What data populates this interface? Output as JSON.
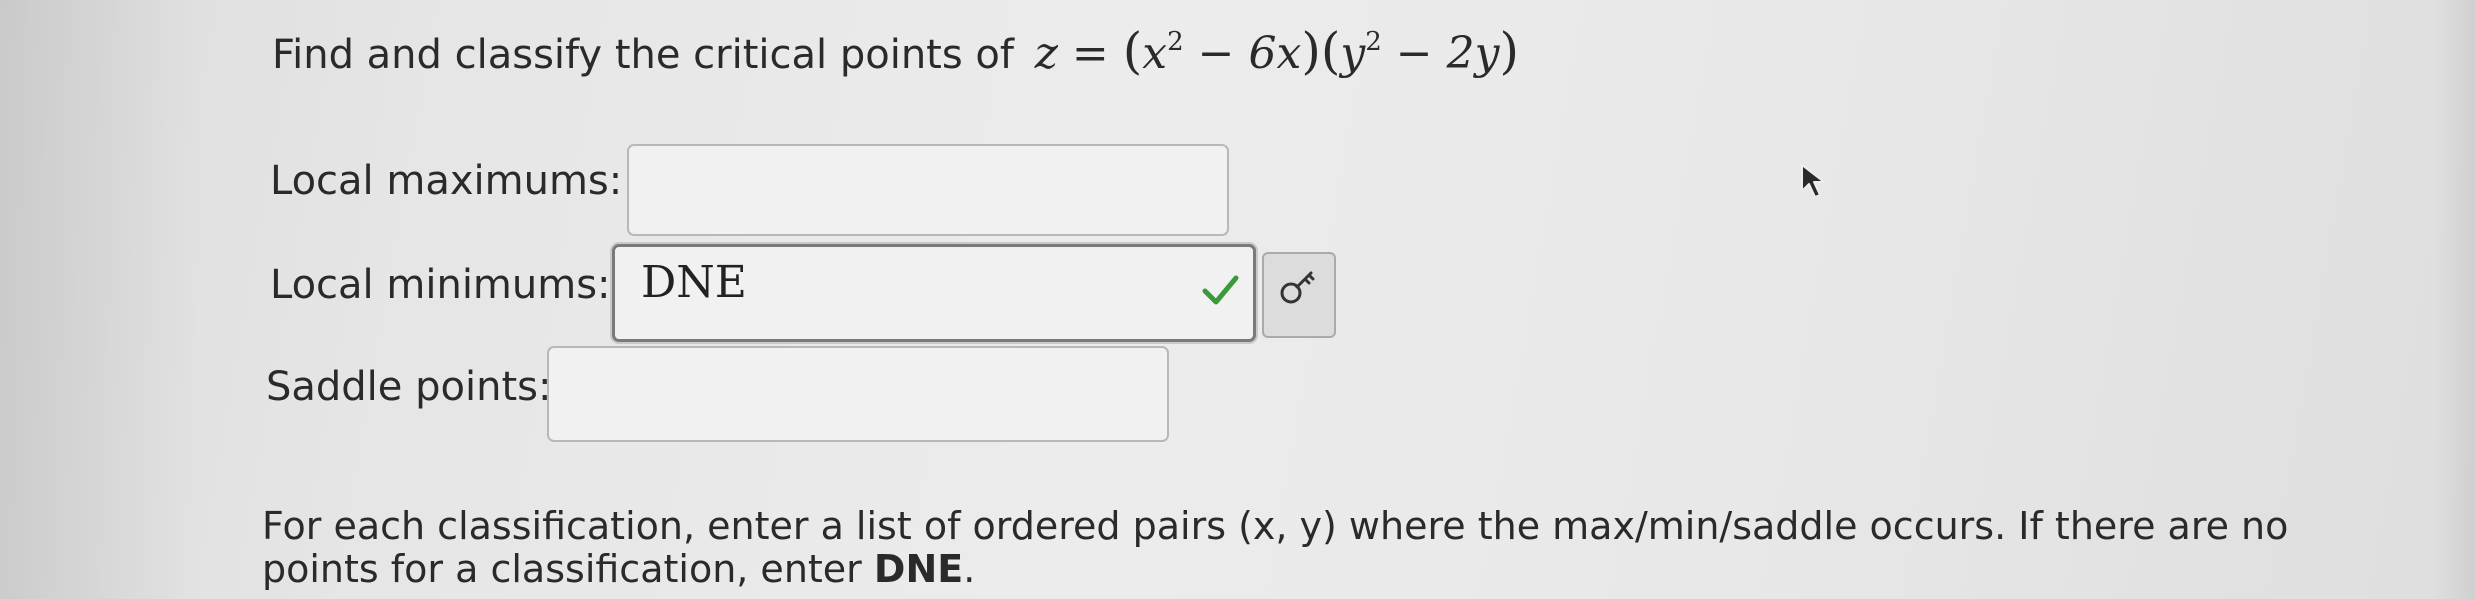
{
  "question": {
    "prompt": "Find and classify the critical points of",
    "equation": {
      "lhs": "z",
      "eq": "=",
      "f1_base": "x",
      "f1_exp": "2",
      "f1_rest": "− 6x",
      "f2_base": "y",
      "f2_exp": "2",
      "f2_rest": "− 2y"
    }
  },
  "fields": {
    "local_max": {
      "label": "Local maximums:",
      "value": ""
    },
    "local_min": {
      "label": "Local minimums:",
      "value": "DNE",
      "status": "correct"
    },
    "saddle": {
      "label": "Saddle points:",
      "value": ""
    }
  },
  "instructions": {
    "text": "For each classification, enter a list of ordered pairs (x, y) where the max/min/saddle occurs. If there are no points for a classification, enter",
    "emphasis": "DNE",
    "end": "."
  },
  "colors": {
    "check": "#3a9a3a",
    "background": "#e8e8e8"
  },
  "icons": {
    "check": "check-icon",
    "key": "key-icon",
    "cursor": "mouse-cursor-icon"
  }
}
